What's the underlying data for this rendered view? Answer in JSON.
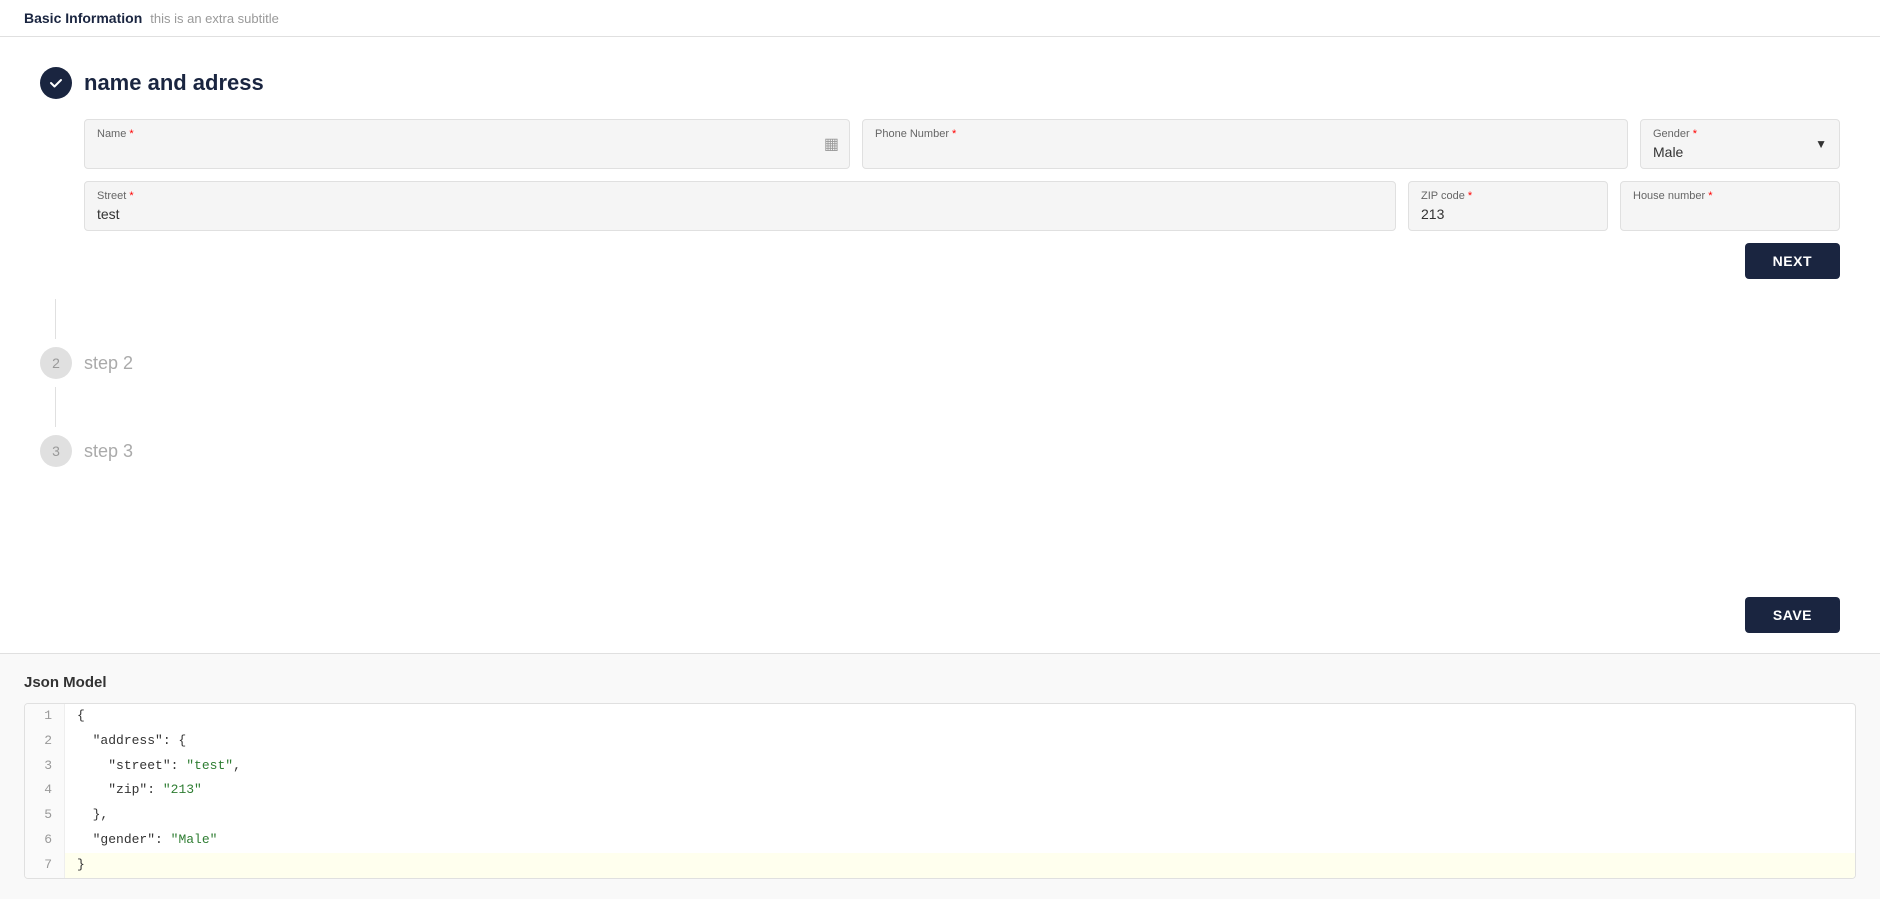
{
  "header": {
    "title": "Basic Information",
    "subtitle": "this is an extra subtitle"
  },
  "step1": {
    "number": "✓",
    "title": "name and adress",
    "fields": {
      "name_label": "Name",
      "name_value": "",
      "name_placeholder": "",
      "phone_label": "Phone Number",
      "phone_value": "",
      "gender_label": "Gender",
      "gender_value": "Male",
      "street_label": "Street",
      "street_value": "test",
      "zip_label": "ZIP code",
      "zip_value": "213",
      "house_label": "House number",
      "house_value": ""
    },
    "next_button": "NEXT"
  },
  "step2": {
    "number": "2",
    "title": "step 2"
  },
  "step3": {
    "number": "3",
    "title": "step 3"
  },
  "save_button": "SAVE",
  "json_section": {
    "title": "Json Model",
    "lines": [
      {
        "num": "1",
        "content": "{",
        "type": "plain"
      },
      {
        "num": "2",
        "content": "  \"address\": {",
        "type": "plain"
      },
      {
        "num": "3",
        "content": "    \"street\": \"test\",",
        "type": "plain"
      },
      {
        "num": "4",
        "content": "    \"zip\": \"213\"",
        "type": "plain"
      },
      {
        "num": "5",
        "content": "  },",
        "type": "plain"
      },
      {
        "num": "6",
        "content": "  \"gender\": \"Male\"",
        "type": "plain"
      },
      {
        "num": "7",
        "content": "}",
        "type": "highlighted"
      }
    ]
  }
}
